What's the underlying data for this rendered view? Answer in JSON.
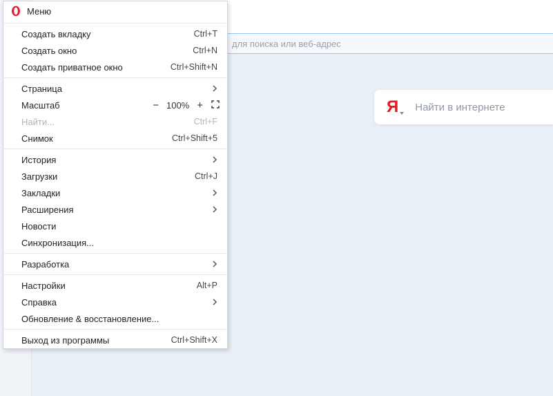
{
  "address_bar": {
    "placeholder": "для поиска или веб-адрес"
  },
  "search_card": {
    "logo_letter": "Я",
    "placeholder": "Найти в интернете"
  },
  "menu": {
    "title": "Меню",
    "items": {
      "new_tab": {
        "label": "Создать вкладку",
        "shortcut": "Ctrl+T"
      },
      "new_window": {
        "label": "Создать окно",
        "shortcut": "Ctrl+N"
      },
      "new_private": {
        "label": "Создать приватное окно",
        "shortcut": "Ctrl+Shift+N"
      },
      "page": {
        "label": "Страница"
      },
      "zoom": {
        "label": "Масштаб",
        "minus": "−",
        "pct": "100%",
        "plus": "+"
      },
      "find": {
        "label": "Найти...",
        "shortcut": "Ctrl+F"
      },
      "snapshot": {
        "label": "Снимок",
        "shortcut": "Ctrl+Shift+5"
      },
      "history": {
        "label": "История"
      },
      "downloads": {
        "label": "Загрузки",
        "shortcut": "Ctrl+J"
      },
      "bookmarks": {
        "label": "Закладки"
      },
      "extensions": {
        "label": "Расширения"
      },
      "news": {
        "label": "Новости"
      },
      "sync": {
        "label": "Синхронизация..."
      },
      "developer": {
        "label": "Разработка"
      },
      "settings": {
        "label": "Настройки",
        "shortcut": "Alt+P"
      },
      "help": {
        "label": "Справка"
      },
      "update": {
        "label": "Обновление & восстановление..."
      },
      "exit": {
        "label": "Выход из программы",
        "shortcut": "Ctrl+Shift+X"
      }
    }
  }
}
